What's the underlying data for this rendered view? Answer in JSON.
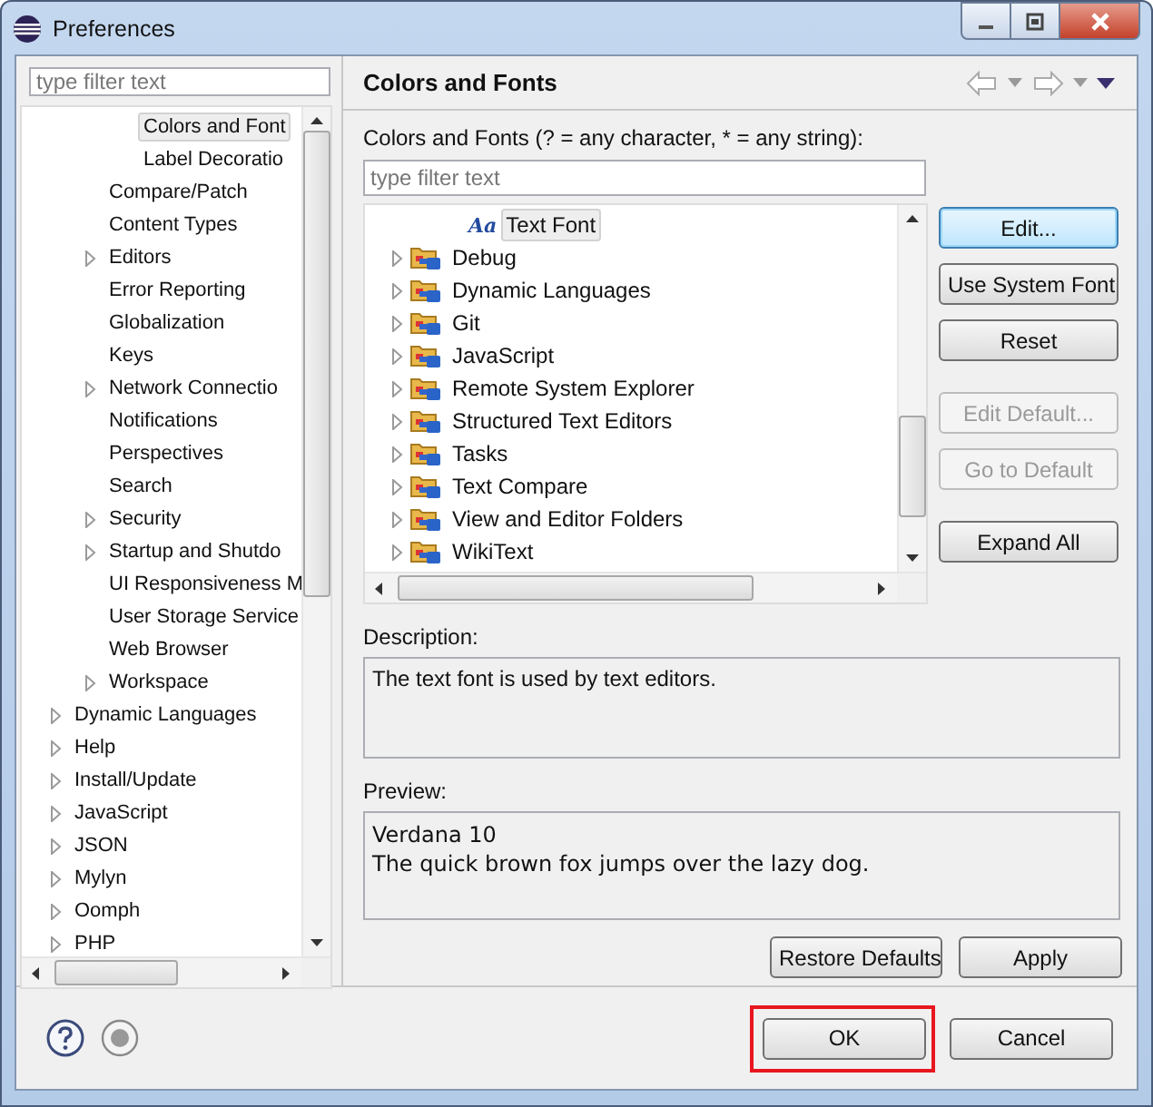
{
  "window": {
    "title": "Preferences"
  },
  "filter": {
    "placeholder": "type filter text"
  },
  "prefs_tree": [
    {
      "children": [
        {
          "children": [
            {
              "label": "Colors and Font",
              "selected": true
            },
            {
              "label": "Label Decoratio",
              "selected": false
            }
          ]
        },
        {
          "label": "Compare/Patch",
          "selected": false
        },
        {
          "label": "Content Types",
          "selected": false
        },
        {
          "label": "Editors",
          "selected": false,
          "expanded": false
        },
        {
          "label": "Error Reporting",
          "selected": false
        },
        {
          "label": "Globalization",
          "selected": false
        },
        {
          "label": "Keys",
          "selected": false
        },
        {
          "label": "Network Connectio",
          "selected": false,
          "expanded": false
        },
        {
          "label": "Notifications",
          "selected": false
        },
        {
          "label": "Perspectives",
          "selected": false
        },
        {
          "label": "Search",
          "selected": false
        },
        {
          "label": "Security",
          "selected": false,
          "expanded": false
        },
        {
          "label": "Startup and Shutdo",
          "selected": false,
          "expanded": false
        },
        {
          "label": "UI Responsiveness M",
          "selected": false
        },
        {
          "label": "User Storage Service",
          "selected": false
        },
        {
          "label": "Web Browser",
          "selected": false
        },
        {
          "label": "Workspace",
          "selected": false,
          "expanded": false
        }
      ]
    },
    {
      "label": "Dynamic Languages",
      "selected": false,
      "expanded": false
    },
    {
      "label": "Help",
      "selected": false,
      "expanded": false
    },
    {
      "label": "Install/Update",
      "selected": false,
      "expanded": false
    },
    {
      "label": "JavaScript",
      "selected": false,
      "expanded": false
    },
    {
      "label": "JSON",
      "selected": false,
      "expanded": false
    },
    {
      "label": "Mylyn",
      "selected": false,
      "expanded": false
    },
    {
      "label": "Oomph",
      "selected": false,
      "expanded": false
    },
    {
      "label": "PHP",
      "selected": false,
      "expanded": false
    }
  ],
  "page": {
    "title": "Colors and Fonts",
    "filter_label": "Colors and Fonts (? = any character, * = any string):",
    "filter_placeholder": "type filter text",
    "tree": [
      {
        "children": [
          {
            "label": "Text Font",
            "kind": "font",
            "icon": "Aa",
            "selected": true
          }
        ]
      },
      {
        "label": "Debug",
        "kind": "category",
        "selected": false,
        "expanded": false
      },
      {
        "label": "Dynamic Languages",
        "kind": "category",
        "selected": false,
        "expanded": false
      },
      {
        "label": "Git",
        "kind": "category",
        "selected": false,
        "expanded": false
      },
      {
        "label": "JavaScript",
        "kind": "category",
        "selected": false,
        "expanded": false
      },
      {
        "label": "Remote System Explorer",
        "kind": "category",
        "selected": false,
        "expanded": false
      },
      {
        "label": "Structured Text Editors",
        "kind": "category",
        "selected": false,
        "expanded": false
      },
      {
        "label": "Tasks",
        "kind": "category",
        "selected": false,
        "expanded": false
      },
      {
        "label": "Text Compare",
        "kind": "category",
        "selected": false,
        "expanded": false
      },
      {
        "label": "View and Editor Folders",
        "kind": "category",
        "selected": false,
        "expanded": false
      },
      {
        "label": "WikiText",
        "kind": "category",
        "selected": false,
        "expanded": false
      }
    ],
    "side_buttons": [
      {
        "label": "Edit...",
        "disabled": false,
        "focused": true
      },
      {
        "label": "Use System Font",
        "disabled": false,
        "focused": false
      },
      {
        "label": "Reset",
        "disabled": false,
        "focused": false
      },
      {
        "label": "Edit Default...",
        "disabled": true,
        "focused": false
      },
      {
        "label": "Go to Default",
        "disabled": true,
        "focused": false
      },
      {
        "label": "Expand All",
        "disabled": false,
        "focused": false
      }
    ],
    "description_label": "Description:",
    "description": "The text font is used by text editors.",
    "preview_label": "Preview:",
    "preview_lines": [
      "Verdana 10",
      "The quick brown fox jumps over the lazy dog."
    ],
    "buttons": [
      "Restore Defaults",
      "Apply"
    ]
  },
  "footer_buttons": [
    {
      "label": "OK",
      "highlighted": true
    },
    {
      "label": "Cancel",
      "highlighted": false
    }
  ]
}
